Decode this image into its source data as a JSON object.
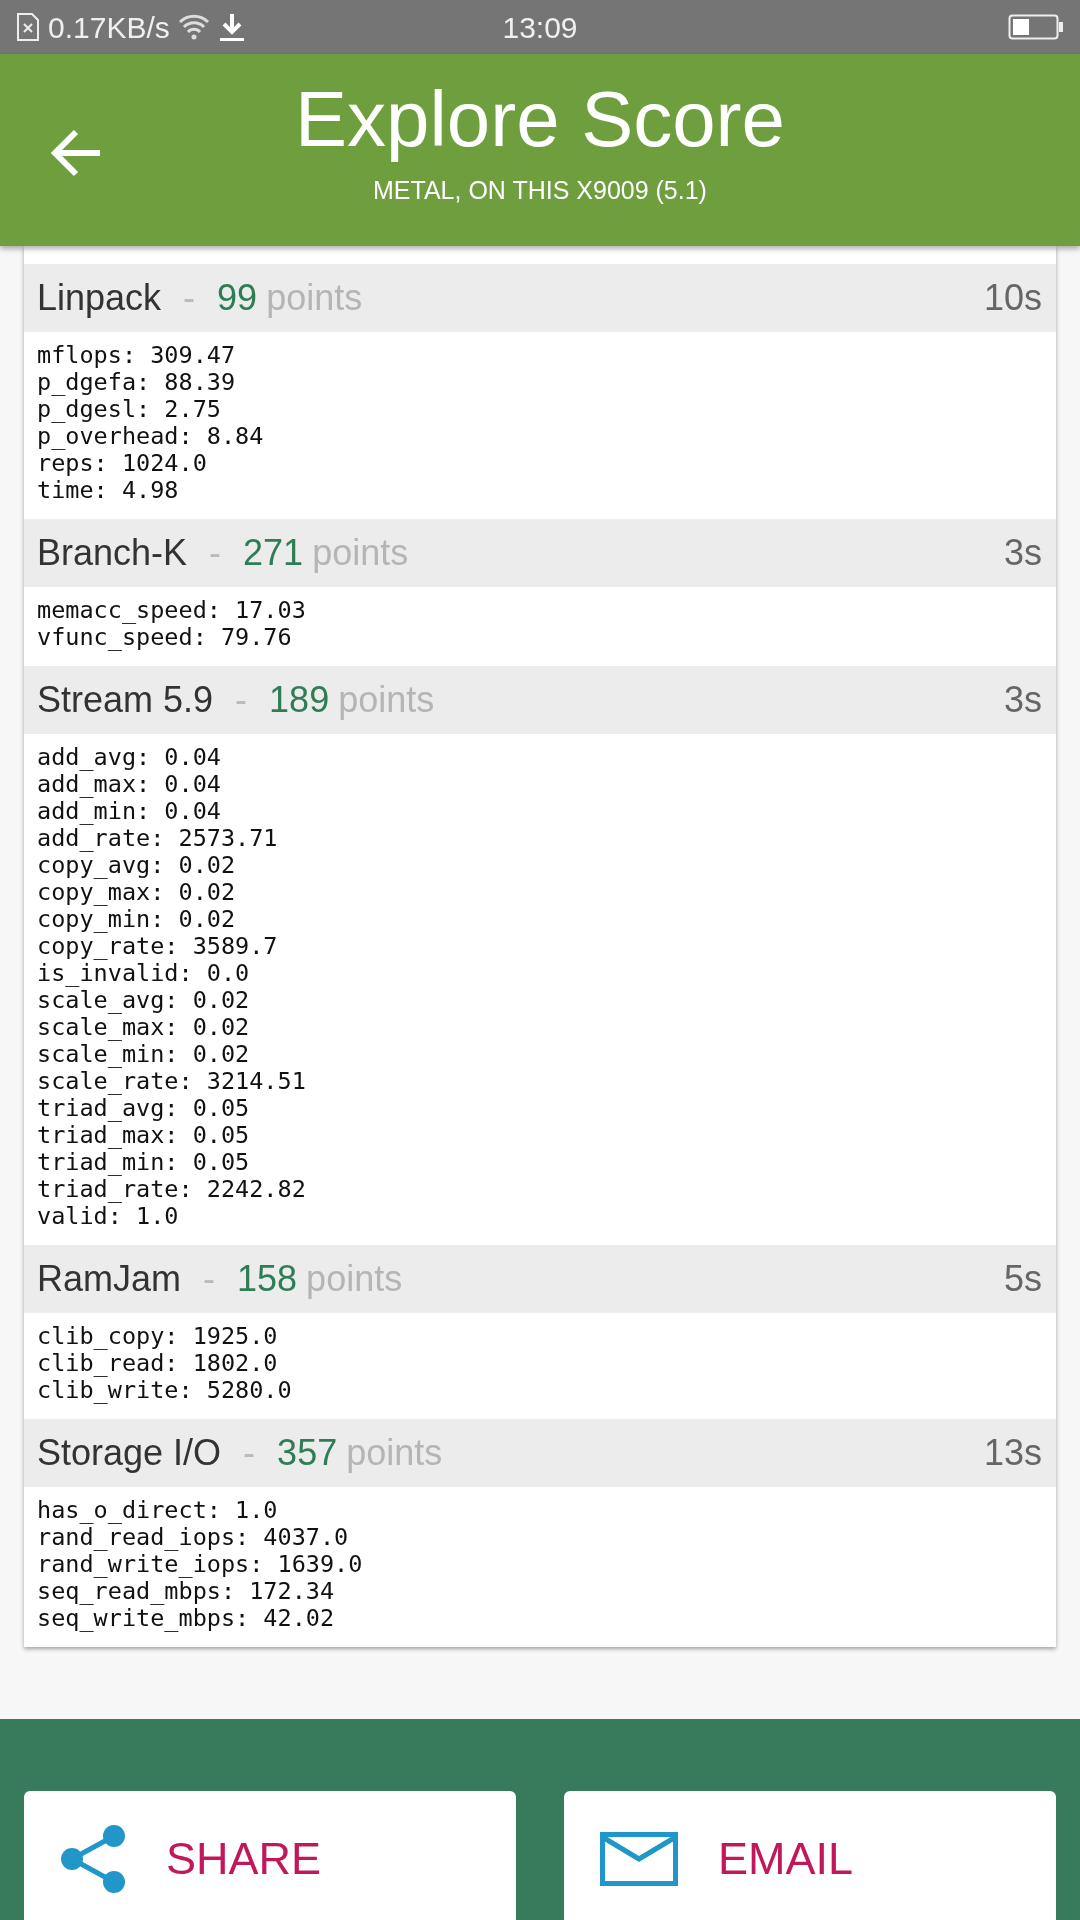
{
  "status_bar": {
    "net_speed": "0.17KB/s",
    "time": "13:09"
  },
  "header": {
    "title": "Explore Score",
    "subtitle": "METAL, ON THIS X9009 (5.1)"
  },
  "sections": [
    {
      "name": "Linpack",
      "separator": "-",
      "score": "99",
      "unit": "points",
      "time": "10s",
      "metrics": [
        "mflops: 309.47",
        "p_dgefa: 88.39",
        "p_dgesl: 2.75",
        "p_overhead: 8.84",
        "reps: 1024.0",
        "time: 4.98"
      ]
    },
    {
      "name": "Branch-K",
      "separator": "-",
      "score": "271",
      "unit": "points",
      "time": "3s",
      "metrics": [
        "memacc_speed: 17.03",
        "vfunc_speed: 79.76"
      ]
    },
    {
      "name": "Stream 5.9",
      "separator": "-",
      "score": "189",
      "unit": "points",
      "time": "3s",
      "metrics": [
        "add_avg: 0.04",
        "add_max: 0.04",
        "add_min: 0.04",
        "add_rate: 2573.71",
        "copy_avg: 0.02",
        "copy_max: 0.02",
        "copy_min: 0.02",
        "copy_rate: 3589.7",
        "is_invalid: 0.0",
        "scale_avg: 0.02",
        "scale_max: 0.02",
        "scale_min: 0.02",
        "scale_rate: 3214.51",
        "triad_avg: 0.05",
        "triad_max: 0.05",
        "triad_min: 0.05",
        "triad_rate: 2242.82",
        "valid: 1.0"
      ]
    },
    {
      "name": "RamJam",
      "separator": "-",
      "score": "158",
      "unit": "points",
      "time": "5s",
      "metrics": [
        "clib_copy: 1925.0",
        "clib_read: 1802.0",
        "clib_write: 5280.0"
      ]
    },
    {
      "name": "Storage I/O",
      "separator": "-",
      "score": "357",
      "unit": "points",
      "time": "13s",
      "metrics": [
        "has_o_direct: 1.0",
        "rand_read_iops: 4037.0",
        "rand_write_iops: 1639.0",
        "seq_read_mbps: 172.34",
        "seq_write_mbps: 42.02"
      ]
    }
  ],
  "actions": [
    {
      "kind": "share",
      "label": "SHARE"
    },
    {
      "kind": "email",
      "label": "EMAIL"
    }
  ]
}
